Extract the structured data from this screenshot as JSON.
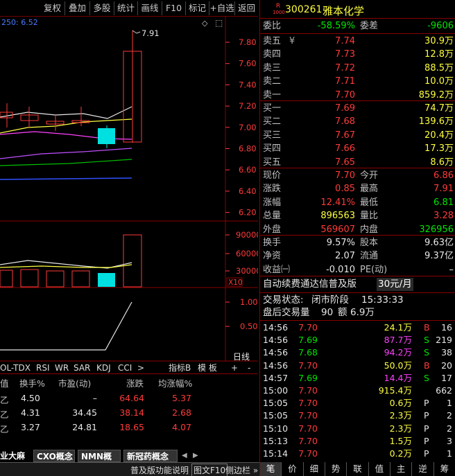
{
  "toolbar": {
    "buttons": [
      "复权",
      "叠加",
      "多股",
      "统计",
      "画线",
      "F10",
      "标记",
      "+自选",
      "返回"
    ]
  },
  "kline": {
    "ma_legend": "250: 6.52",
    "high_marker": "7.91",
    "price_ticks": [
      "7.80",
      "7.60",
      "7.40",
      "7.20",
      "7.00",
      "6.80",
      "6.60",
      "6.40",
      "6.20"
    ],
    "volume_ticks": [
      "90000",
      "60000",
      "30000"
    ],
    "volume_unit": "X10",
    "indicator_ticks": [
      "1.00",
      "0.50"
    ],
    "period_label": "日线"
  },
  "indicator_tabs": [
    "OL-TDX",
    "RSI",
    "WR",
    "SAR",
    "KDJ",
    "CCI",
    ">"
  ],
  "indicator_right": [
    "指标B",
    "模 板",
    "+",
    "-"
  ],
  "sector_table": {
    "headers": [
      "值",
      "换手%",
      "市盈(动)",
      "涨跌",
      "均涨幅%"
    ],
    "rows": [
      [
        "乙",
        "4.50",
        "–",
        "64.64",
        "5.37"
      ],
      [
        "乙",
        "4.31",
        "34.45",
        "38.14",
        "2.68"
      ],
      [
        "乙",
        "3.27",
        "24.81",
        "18.65",
        "4.07"
      ]
    ]
  },
  "sector_tabs": [
    "业大麻",
    "CXO概念",
    "NMN概念",
    "新冠药概念"
  ],
  "status_bar": {
    "hint": "普及版功能说明",
    "f10": "图文F10",
    "sidebar": "侧边栏 »"
  },
  "stock": {
    "badge_top": "R",
    "badge_bottom": "1000",
    "code": "300261",
    "name": "雅本化学"
  },
  "order_ratio": {
    "label1": "委比",
    "value1": "-58.59%",
    "label2": "委差",
    "value2": "-9606"
  },
  "asks": [
    {
      "label": "卖五",
      "mark": "¥",
      "price": "7.74",
      "vol": "30.9万"
    },
    {
      "label": "卖四",
      "mark": "",
      "price": "7.73",
      "vol": "12.8万"
    },
    {
      "label": "卖三",
      "mark": "",
      "price": "7.72",
      "vol": "88.5万"
    },
    {
      "label": "卖二",
      "mark": "",
      "price": "7.71",
      "vol": "10.0万"
    },
    {
      "label": "卖一",
      "mark": "",
      "price": "7.70",
      "vol": "859.2万"
    }
  ],
  "bids": [
    {
      "label": "买一",
      "price": "7.69",
      "vol": "74.7万"
    },
    {
      "label": "买二",
      "price": "7.68",
      "vol": "139.6万"
    },
    {
      "label": "买三",
      "price": "7.67",
      "vol": "20.4万"
    },
    {
      "label": "买四",
      "price": "7.66",
      "vol": "17.3万"
    },
    {
      "label": "买五",
      "price": "7.65",
      "vol": "8.6万"
    }
  ],
  "stats": [
    {
      "l1": "现价",
      "v1": "7.70",
      "l2": "今开",
      "v2": "6.86"
    },
    {
      "l1": "涨跌",
      "v1": "0.85",
      "l2": "最高",
      "v2": "7.91"
    },
    {
      "l1": "涨幅",
      "v1": "12.41%",
      "l2": "最低",
      "v2": "6.81"
    },
    {
      "l1": "总量",
      "v1": "896563",
      "l2": "量比",
      "v2": "3.28"
    },
    {
      "l1": "外盘",
      "v1": "569607",
      "l2": "内盘",
      "v2": "326956"
    }
  ],
  "stats2": [
    {
      "l1": "换手",
      "v1": "9.57%",
      "l2": "股本",
      "v2": "9.63亿"
    },
    {
      "l1": "净资",
      "v1": "2.07",
      "l2": "流通",
      "v2": "9.37亿"
    },
    {
      "l1": "收益㈠",
      "v1": "-0.010",
      "l2": "PE(动)",
      "v2": "–"
    }
  ],
  "promo": {
    "text": "自动续费通达信普及版",
    "price": "30元/月"
  },
  "trade_status": {
    "label": "交易状态:",
    "status": "闭市阶段",
    "time": "15:33:33",
    "after_label": "盘后交易量",
    "after_vol": "90",
    "amount_label": "额",
    "amount": "6.9万"
  },
  "ticks": [
    {
      "t": "14:56",
      "p": "7.70",
      "v": "24.1万",
      "s": "B",
      "n": "16"
    },
    {
      "t": "14:56",
      "p": "7.69",
      "v": "87.7万",
      "s": "S",
      "n": "219"
    },
    {
      "t": "14:56",
      "p": "7.68",
      "v": "94.2万",
      "s": "S",
      "n": "38"
    },
    {
      "t": "14:56",
      "p": "7.70",
      "v": "50.0万",
      "s": "B",
      "n": "20"
    },
    {
      "t": "14:57",
      "p": "7.69",
      "v": "14.4万",
      "s": "S",
      "n": "17"
    },
    {
      "t": "15:00",
      "p": "7.70",
      "v": "915.4万",
      "s": "",
      "n": "662"
    },
    {
      "t": "15:05",
      "p": "7.70",
      "v": "0.6万",
      "s": "P",
      "n": "1"
    },
    {
      "t": "15:05",
      "p": "7.70",
      "v": "2.3万",
      "s": "P",
      "n": "2"
    },
    {
      "t": "15:10",
      "p": "7.70",
      "v": "2.3万",
      "s": "P",
      "n": "2"
    },
    {
      "t": "15:13",
      "p": "7.70",
      "v": "1.5万",
      "s": "P",
      "n": "3"
    },
    {
      "t": "15:14",
      "p": "7.70",
      "v": "0.2万",
      "s": "P",
      "n": "1"
    }
  ],
  "bottom_tabs": [
    "笔",
    "价",
    "细",
    "势",
    "联",
    "值",
    "主",
    "逆",
    "筹"
  ]
}
